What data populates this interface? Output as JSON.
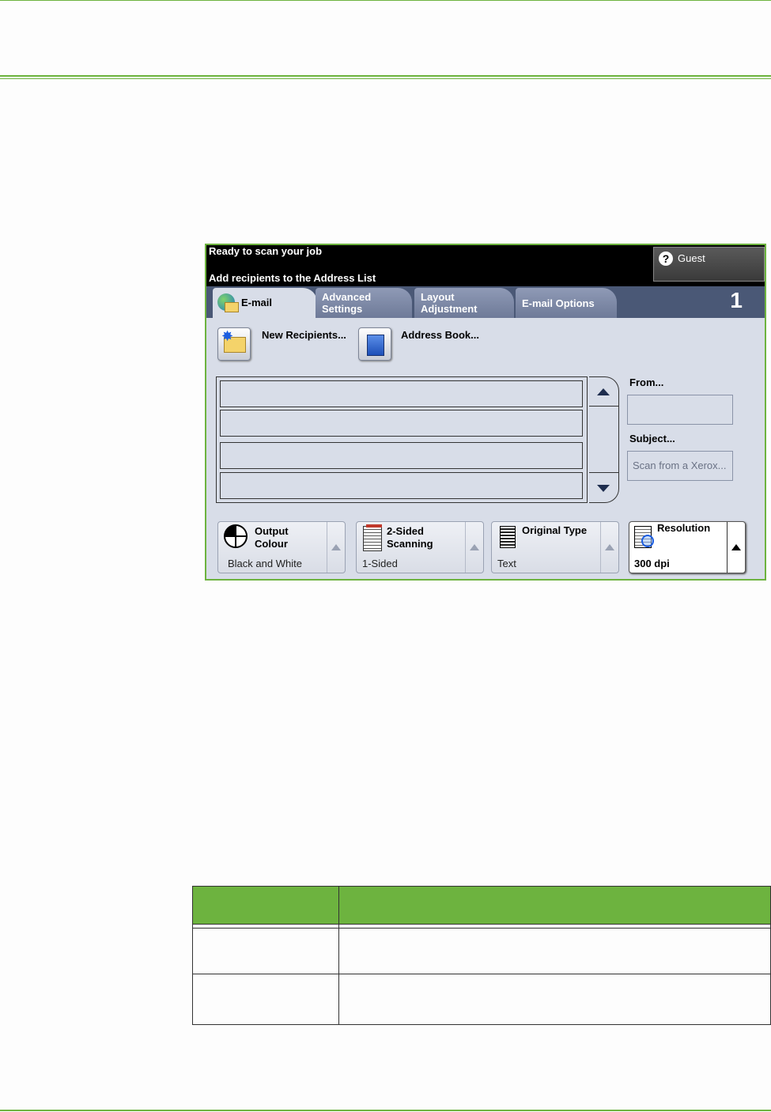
{
  "device": {
    "status_line1": "Ready to scan your job",
    "status_line2": "Add recipients to the Address List",
    "user_label": "Guest",
    "job_count": "1",
    "tabs": [
      {
        "label": "E-mail"
      },
      {
        "label_line1": "Advanced",
        "label_line2": "Settings"
      },
      {
        "label_line1": "Layout",
        "label_line2": "Adjustment"
      },
      {
        "label": "E-mail Options"
      }
    ],
    "toolbar": {
      "new_recipients": "New Recipients...",
      "address_book": "Address Book..."
    },
    "fields": {
      "from_label": "From...",
      "from_value": "",
      "subject_label": "Subject...",
      "subject_value": "Scan from a Xerox..."
    },
    "features": [
      {
        "title_line1": "Output",
        "title_line2": "Colour",
        "value": "Black and White"
      },
      {
        "title_line1": "2-Sided",
        "title_line2": "Scanning",
        "value": "1-Sided"
      },
      {
        "title_line1": "Original Type",
        "value": "Text"
      },
      {
        "title_line1": "Resolution",
        "value": "300 dpi"
      }
    ],
    "colors": {
      "accent_green": "#6db33f",
      "tabbar": "#4a5876",
      "panel": "#d8dde8"
    }
  }
}
